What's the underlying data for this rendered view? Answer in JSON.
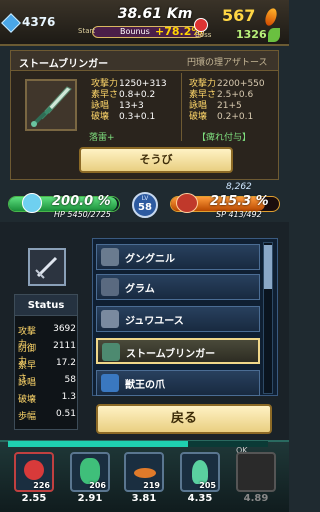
{
  "topbar": {
    "gems": "4376",
    "distance": "38.61 Km",
    "start_label": "Start",
    "boss_label": "Boss",
    "bonus_label": "Bounus",
    "bonus_value": "+78.2%",
    "gold": "567",
    "leaves": "1326"
  },
  "equip": {
    "weapon_name": "ストームブリンガー",
    "compare_name": "円環の理アザトース",
    "stats_labels": [
      "攻撃力",
      "素早さ",
      "詠唱",
      "破壊"
    ],
    "current_values": [
      "1250+313",
      "0.8+0.2",
      "13+3",
      "0.3+0.1"
    ],
    "compare_values": [
      "2200+550",
      "2.5+0.6",
      "21+5",
      "0.2+0.1"
    ],
    "current_rune": "落雷+",
    "compare_rune": "【痺れ付与】",
    "equip_button": "そうび"
  },
  "hud": {
    "hp_percent": "200.0 %",
    "hp_text": "HP 5450/2725",
    "lv_label": "LV",
    "level": "58",
    "sp_percent": "215.3 %",
    "sp_text": "SP 413/492",
    "exp": "8,262"
  },
  "status": {
    "title": "Status",
    "rows": [
      {
        "label": "攻撃力",
        "value": "3692"
      },
      {
        "label": "防御力",
        "value": "2111"
      },
      {
        "label": "素早さ",
        "value": "17.2"
      },
      {
        "label": "詠唱",
        "value": "58"
      },
      {
        "label": "破壊",
        "value": "1.3"
      },
      {
        "label": "歩幅",
        "value": "0.51"
      }
    ]
  },
  "weapon_list": {
    "items": [
      {
        "label": "グングニル",
        "color": "#6a7b8f"
      },
      {
        "label": "グラム",
        "color": "#5a6a80"
      },
      {
        "label": "ジュワユース",
        "color": "#7a8a9f"
      },
      {
        "label": "ストームブリンガー",
        "color": "#4d8a70"
      },
      {
        "label": "獣王の爪",
        "color": "#3a78c0"
      }
    ]
  },
  "back_button": "戻る",
  "skills": [
    {
      "name": "heart-skill",
      "count": "226",
      "cost": "2.55",
      "color": "#d83a3a"
    },
    {
      "name": "spirit-skill",
      "count": "206",
      "cost": "2.91",
      "color": "#3fbf7a"
    },
    {
      "name": "fire-skill",
      "count": "219",
      "cost": "3.81",
      "color": "#e07a2a"
    },
    {
      "name": "flame-skill",
      "count": "205",
      "cost": "4.35",
      "color": "#5ad0a0"
    },
    {
      "name": "locked-skill",
      "count": "",
      "cost": "4.89",
      "color": "#444"
    }
  ],
  "ok_label": "OK"
}
